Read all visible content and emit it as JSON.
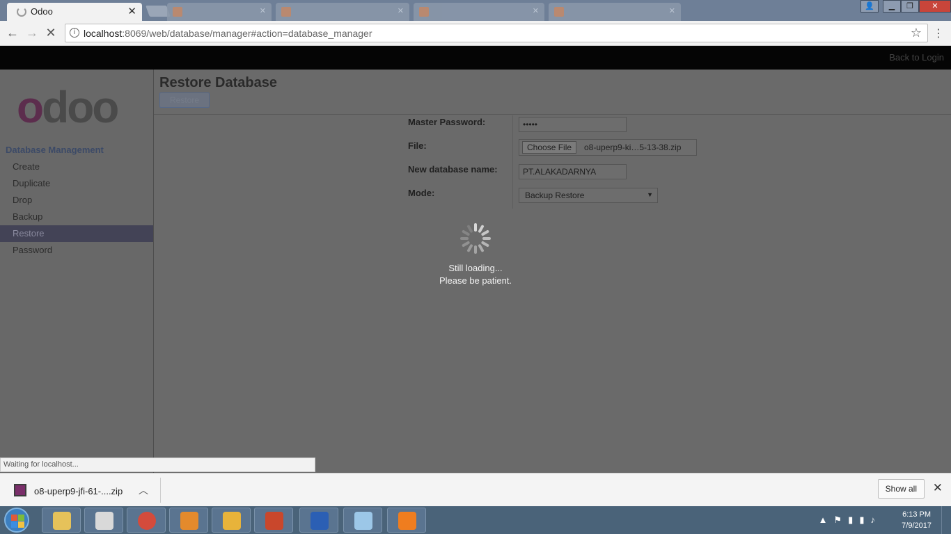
{
  "browser": {
    "active_tab": {
      "title": "Odoo"
    },
    "background_tabs": [
      {
        "title": ""
      },
      {
        "title": ""
      },
      {
        "title": ""
      },
      {
        "title": ""
      }
    ],
    "url_host": "localhost",
    "url_rest": ":8069/web/database/manager#action=database_manager",
    "status_text": "Waiting for localhost..."
  },
  "app": {
    "back_to_login": "Back to Login",
    "logo_text": "odoo",
    "sidebar_title": "Database Management",
    "sidebar_items": [
      {
        "label": "Create"
      },
      {
        "label": "Duplicate"
      },
      {
        "label": "Drop"
      },
      {
        "label": "Backup"
      },
      {
        "label": "Restore",
        "active": true
      },
      {
        "label": "Password"
      }
    ],
    "page_title": "Restore Database",
    "restore_button": "Restore",
    "form": {
      "master_password_label": "Master Password:",
      "master_password_value": "•••••",
      "file_label": "File:",
      "choose_file_button": "Choose File",
      "file_name": "o8-uperp9-ki…5-13-38.zip",
      "new_db_label": "New database name:",
      "new_db_value": "PT.ALAKADARNYA",
      "mode_label": "Mode:",
      "mode_value": "Backup Restore"
    },
    "loading": {
      "line1": "Still loading...",
      "line2": "Please be patient."
    }
  },
  "downloads": {
    "item_name": "o8-uperp9-jfi-61-....zip",
    "show_all": "Show all"
  },
  "taskbar": {
    "time": "6:13 PM",
    "date": "7/9/2017"
  },
  "colors": {
    "sidebar_active_bg": "#434356",
    "odoo_purple": "#5c2d4d",
    "taskbar_bg": "#4a6379"
  }
}
